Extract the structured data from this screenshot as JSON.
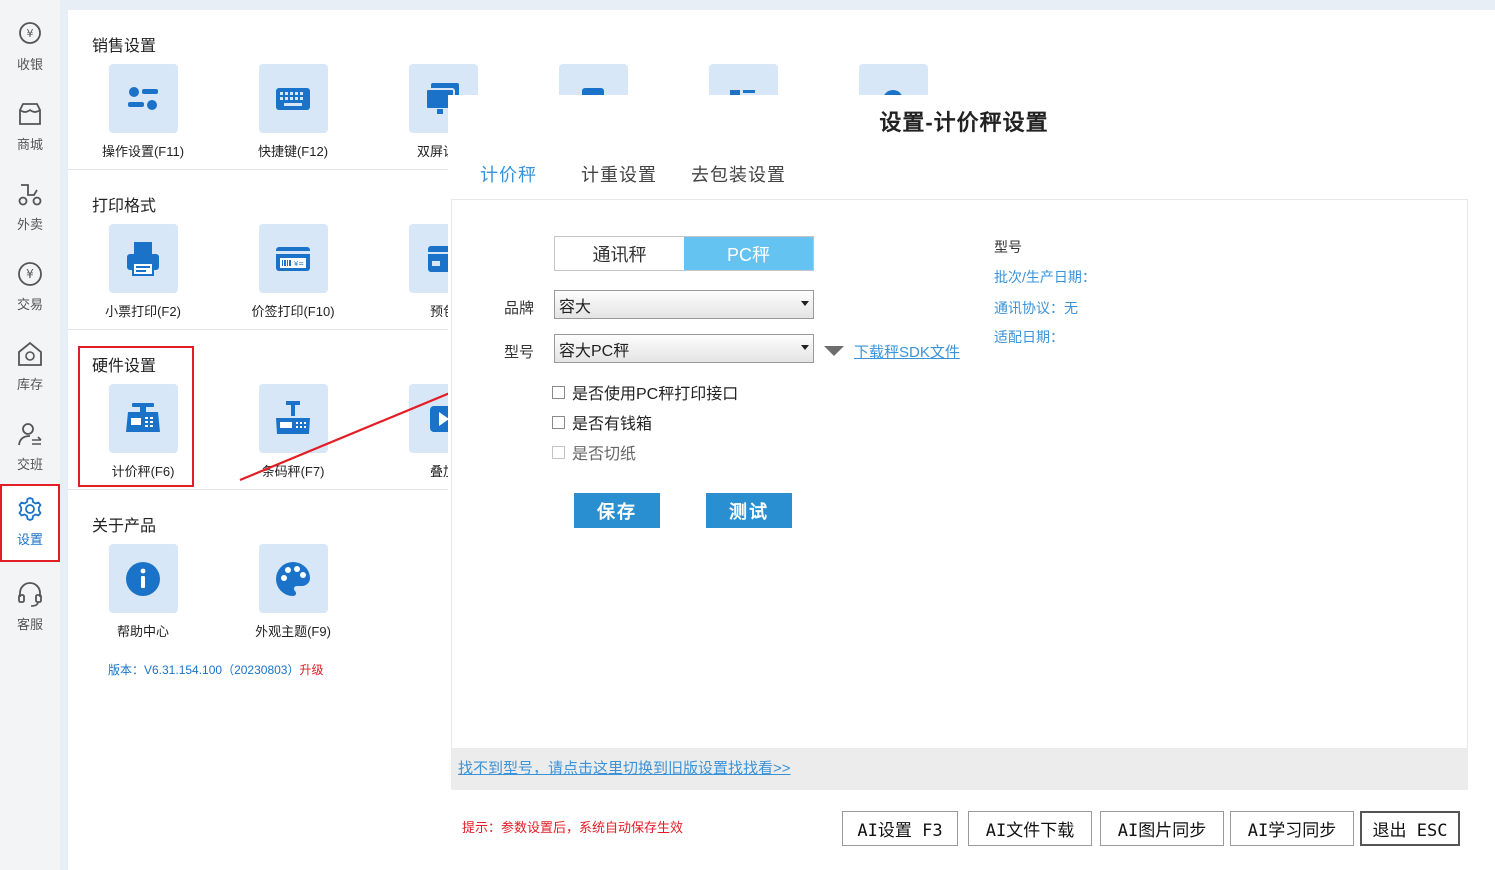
{
  "sidebar": {
    "items": [
      {
        "label": "收银",
        "icon": "cashier-icon"
      },
      {
        "label": "商城",
        "icon": "store-icon"
      },
      {
        "label": "外卖",
        "icon": "delivery-icon"
      },
      {
        "label": "交易",
        "icon": "transaction-icon"
      },
      {
        "label": "库存",
        "icon": "inventory-icon"
      },
      {
        "label": "交班",
        "icon": "shift-handover-icon"
      },
      {
        "label": "设置",
        "icon": "gear-icon",
        "active": true
      },
      {
        "label": "客服",
        "icon": "headset-icon"
      }
    ]
  },
  "settings": {
    "sections": [
      {
        "title": "销售设置",
        "tiles": [
          "操作设置(F11)",
          "快捷键(F12)",
          "双屏设置"
        ]
      },
      {
        "title": "打印格式",
        "tiles": [
          "小票打印(F2)",
          "价签打印(F10)",
          "预包"
        ]
      },
      {
        "title": "硬件设置",
        "tiles": [
          "计价秤(F6)",
          "条码秤(F7)",
          "叠加"
        ]
      },
      {
        "title": "关于产品",
        "tiles": [
          "帮助中心",
          "外观主题(F9)"
        ]
      }
    ],
    "version_text": "版本：V6.31.154.100（20230803）",
    "upgrade_label": "升级"
  },
  "dialog": {
    "title": "设置-计价秤设置",
    "tabs": [
      "计价秤",
      "计重设置",
      "去包装设置"
    ],
    "scale_type": {
      "options": [
        "通讯秤",
        "PC秤"
      ],
      "selected": "PC秤"
    },
    "brand_label": "品牌",
    "brand_value": "容大",
    "model_label": "型号",
    "model_value": "容大PC秤",
    "sdk_link": "下载秤SDK文件",
    "checkboxes": [
      {
        "label": "是否使用PC秤打印接口",
        "checked": false,
        "enabled": true
      },
      {
        "label": "是否有钱箱",
        "checked": false,
        "enabled": true
      },
      {
        "label": "是否切纸",
        "checked": false,
        "enabled": false
      }
    ],
    "save_label": "保存",
    "test_label": "测试",
    "info": {
      "model_title": "型号",
      "batch_label": "批次/生产日期：",
      "protocol_label": "通讯协议：无",
      "adapt_label": "适配日期："
    },
    "old_settings_link": "找不到型号，请点击这里切换到旧版设置找找看>>",
    "tip": "提示：参数设置后，系统自动保存生效",
    "footer_buttons": [
      "AI设置 F3",
      "AI文件下载",
      "AI图片同步",
      "AI学习同步",
      "退出 ESC"
    ]
  },
  "colors": {
    "accent": "#3a93d8",
    "primary_button": "#2a8fd0",
    "active_segment": "#64c3f1",
    "alert": "#e21d25",
    "tile_bg": "#d7e7f7"
  }
}
